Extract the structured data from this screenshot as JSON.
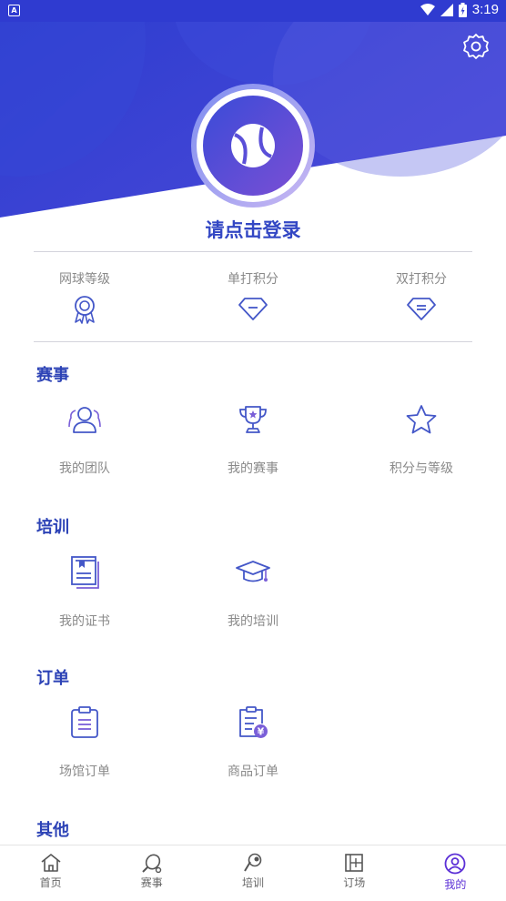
{
  "status_bar": {
    "app_badge": "A",
    "time": "3:19"
  },
  "profile": {
    "login_prompt": "请点击登录"
  },
  "stats": [
    {
      "label": "网球等级",
      "icon": "medal-icon"
    },
    {
      "label": "单打积分",
      "icon": "diamond-minus-icon"
    },
    {
      "label": "双打积分",
      "icon": "diamond-equal-icon"
    }
  ],
  "sections": {
    "events": {
      "title": "赛事",
      "items": [
        {
          "label": "我的团队",
          "icon": "team-icon"
        },
        {
          "label": "我的赛事",
          "icon": "trophy-icon"
        },
        {
          "label": "积分与等级",
          "icon": "star-icon"
        }
      ]
    },
    "training": {
      "title": "培训",
      "items": [
        {
          "label": "我的证书",
          "icon": "certificate-icon"
        },
        {
          "label": "我的培训",
          "icon": "graduation-cap-icon"
        }
      ]
    },
    "orders": {
      "title": "订单",
      "items": [
        {
          "label": "场馆订单",
          "icon": "clipboard-icon"
        },
        {
          "label": "商品订单",
          "icon": "yen-receipt-icon"
        }
      ]
    },
    "other": {
      "title": "其他"
    }
  },
  "tabbar": [
    {
      "label": "首页",
      "icon": "home-icon"
    },
    {
      "label": "赛事",
      "icon": "racket-icon"
    },
    {
      "label": "培训",
      "icon": "training-icon"
    },
    {
      "label": "订场",
      "icon": "court-icon"
    },
    {
      "label": "我的",
      "icon": "user-icon",
      "active": true
    }
  ],
  "colors": {
    "primary": "#3347c4",
    "accent": "#5b2fd6",
    "label_gray": "#8a8a8a"
  }
}
